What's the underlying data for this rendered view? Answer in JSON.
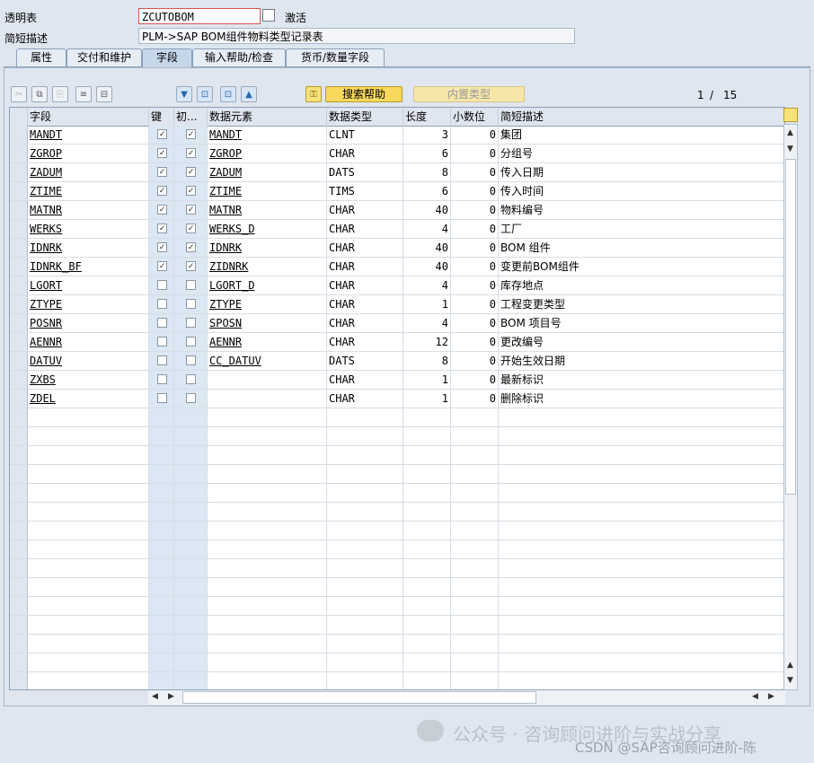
{
  "header": {
    "table_label": "透明表",
    "table_value": "ZCUTOBOM",
    "status": "激活",
    "desc_label": "简短描述",
    "desc_value": "PLM->SAP BOM组件物料类型记录表"
  },
  "tabs": [
    "属性",
    "交付和维护",
    "字段",
    "输入帮助/检查",
    "货币/数量字段"
  ],
  "active_tab": "字段",
  "toolbar": {
    "search_help": "搜索帮助",
    "builtin_type": "内置类型",
    "page": "1",
    "page_sep": "/",
    "page_total": "15"
  },
  "columns": [
    "字段",
    "键",
    "初...",
    "数据元素",
    "数据类型",
    "长度",
    "小数位",
    "简短描述"
  ],
  "rows": [
    {
      "field": "MANDT",
      "key": true,
      "init": true,
      "element": "MANDT",
      "type": "CLNT",
      "len": "3",
      "dec": "0",
      "desc": "集团"
    },
    {
      "field": "ZGROP",
      "key": true,
      "init": true,
      "element": "ZGROP",
      "type": "CHAR",
      "len": "6",
      "dec": "0",
      "desc": "分组号"
    },
    {
      "field": "ZADUM",
      "key": true,
      "init": true,
      "element": "ZADUM",
      "type": "DATS",
      "len": "8",
      "dec": "0",
      "desc": "传入日期"
    },
    {
      "field": "ZTIME",
      "key": true,
      "init": true,
      "element": "ZTIME",
      "type": "TIMS",
      "len": "6",
      "dec": "0",
      "desc": "传入时间"
    },
    {
      "field": "MATNR",
      "key": true,
      "init": true,
      "element": "MATNR",
      "type": "CHAR",
      "len": "40",
      "dec": "0",
      "desc": "物料编号"
    },
    {
      "field": "WERKS",
      "key": true,
      "init": true,
      "element": "WERKS_D",
      "type": "CHAR",
      "len": "4",
      "dec": "0",
      "desc": "工厂"
    },
    {
      "field": "IDNRK",
      "key": true,
      "init": true,
      "element": "IDNRK",
      "type": "CHAR",
      "len": "40",
      "dec": "0",
      "desc": "BOM 组件"
    },
    {
      "field": "IDNRK_BF",
      "key": true,
      "init": true,
      "element": "ZIDNRK",
      "type": "CHAR",
      "len": "40",
      "dec": "0",
      "desc": "变更前BOM组件"
    },
    {
      "field": "LGORT",
      "key": false,
      "init": false,
      "element": "LGORT_D",
      "type": "CHAR",
      "len": "4",
      "dec": "0",
      "desc": "库存地点"
    },
    {
      "field": "ZTYPE",
      "key": false,
      "init": false,
      "element": "ZTYPE",
      "type": "CHAR",
      "len": "1",
      "dec": "0",
      "desc": "工程变更类型"
    },
    {
      "field": "POSNR",
      "key": false,
      "init": false,
      "element": "SPOSN",
      "type": "CHAR",
      "len": "4",
      "dec": "0",
      "desc": "BOM 项目号"
    },
    {
      "field": "AENNR",
      "key": false,
      "init": false,
      "element": "AENNR",
      "type": "CHAR",
      "len": "12",
      "dec": "0",
      "desc": "更改编号"
    },
    {
      "field": "DATUV",
      "key": false,
      "init": false,
      "element": "CC_DATUV",
      "type": "DATS",
      "len": "8",
      "dec": "0",
      "desc": "开始生效日期"
    },
    {
      "field": "ZXBS",
      "key": false,
      "init": false,
      "element": "",
      "type": "CHAR",
      "len": "1",
      "dec": "0",
      "desc": "最新标识"
    },
    {
      "field": "ZDEL",
      "key": false,
      "init": false,
      "element": "",
      "type": "CHAR",
      "len": "1",
      "dec": "0",
      "desc": "删除标识"
    }
  ],
  "empty_rows": 15,
  "watermark": {
    "line1": "公众号 · 咨询顾问进阶与实战分享",
    "line2": "CSDN @SAP咨询顾问进阶-陈"
  },
  "colors": {
    "background": "#dfe6ef",
    "header": "#dfe6ef",
    "button_yellow": "#f8d95e",
    "required_border": "#d9534f"
  }
}
